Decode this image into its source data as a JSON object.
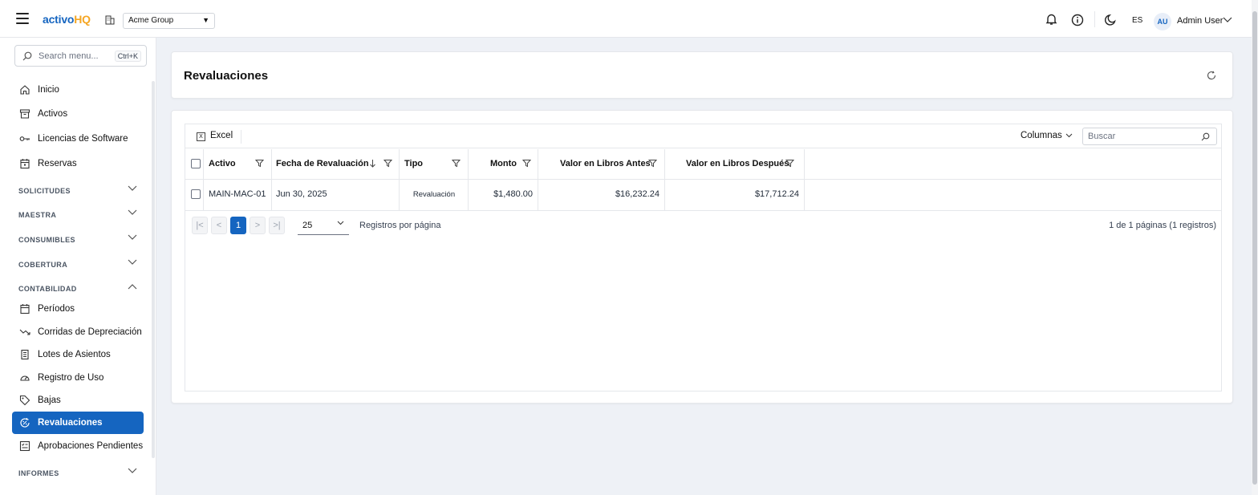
{
  "app": {
    "logo_part1": "activo",
    "logo_part2": "HQ",
    "organization": "Acme Group",
    "language": "ES",
    "user_initials": "AU",
    "user_name": "Admin User"
  },
  "sidebar": {
    "search_placeholder": "Search menu...",
    "search_shortcut": "Ctrl+K",
    "top_items": [
      {
        "label": "Inicio",
        "icon": "home-icon"
      },
      {
        "label": "Activos",
        "icon": "archive-icon"
      },
      {
        "label": "Licencias de Software",
        "icon": "key-icon"
      },
      {
        "label": "Reservas",
        "icon": "calendar-check-icon"
      }
    ],
    "sections": [
      {
        "label": "SOLICITUDES",
        "expanded": false
      },
      {
        "label": "MAESTRA",
        "expanded": false
      },
      {
        "label": "CONSUMIBLES",
        "expanded": false
      },
      {
        "label": "COBERTURA",
        "expanded": false
      },
      {
        "label": "CONTABILIDAD",
        "expanded": true
      },
      {
        "label": "INFORMES",
        "expanded": false
      }
    ],
    "accounting_items": [
      {
        "label": "Períodos",
        "icon": "calendar-icon"
      },
      {
        "label": "Corridas de Depreciación",
        "icon": "trend-down-icon"
      },
      {
        "label": "Lotes de Asientos",
        "icon": "receipt-icon"
      },
      {
        "label": "Registro de Uso",
        "icon": "gauge-icon"
      },
      {
        "label": "Bajas",
        "icon": "tag-icon"
      },
      {
        "label": "Revaluaciones",
        "icon": "revaluation-icon",
        "active": true
      },
      {
        "label": "Aprobaciones Pendientes",
        "icon": "approval-list-icon"
      }
    ]
  },
  "page": {
    "title": "Revaluaciones"
  },
  "toolbar": {
    "excel_label": "Excel",
    "columns_label": "Columnas",
    "search_placeholder": "Buscar"
  },
  "table": {
    "columns": [
      "Activo",
      "Fecha de Revaluación",
      "Tipo",
      "Monto",
      "Valor en Libros Antes",
      "Valor en Libros Después"
    ],
    "rows": [
      {
        "asset": "MAIN-MAC-01",
        "date": "Jun 30, 2025",
        "type": "Revaluación",
        "amount": "$1,480.00",
        "book_before": "$16,232.24",
        "book_after": "$17,712.24"
      }
    ]
  },
  "pagination": {
    "current_page": "1",
    "per_page": "25",
    "per_page_label": "Registros por página",
    "info": "1 de 1 páginas (1 registros)"
  },
  "colors": {
    "accent": "#1565c0",
    "logo_hq": "#f5a623",
    "background": "#eef1f6"
  }
}
